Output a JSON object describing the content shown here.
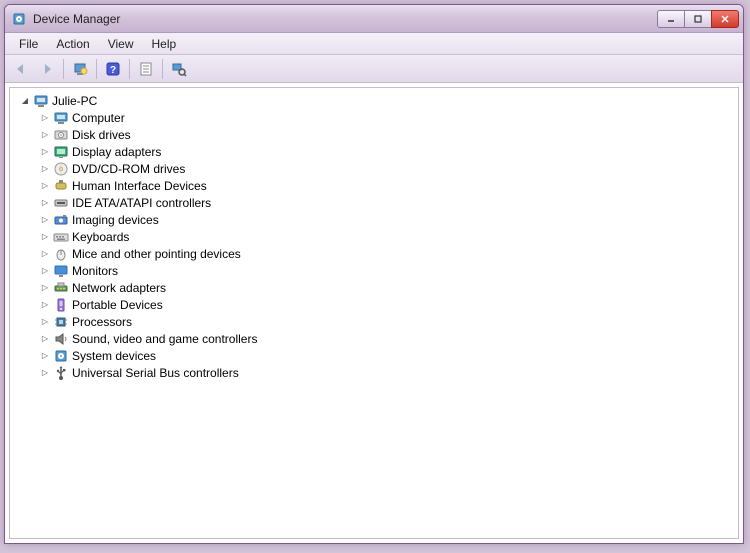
{
  "window": {
    "title": "Device Manager"
  },
  "menu": {
    "file": "File",
    "action": "Action",
    "view": "View",
    "help": "Help"
  },
  "tree": {
    "root": {
      "label": "Julie-PC",
      "icon": "computer"
    },
    "nodes": [
      {
        "label": "Computer",
        "icon": "computer"
      },
      {
        "label": "Disk drives",
        "icon": "disk"
      },
      {
        "label": "Display adapters",
        "icon": "display"
      },
      {
        "label": "DVD/CD-ROM drives",
        "icon": "dvd"
      },
      {
        "label": "Human Interface Devices",
        "icon": "hid"
      },
      {
        "label": "IDE ATA/ATAPI controllers",
        "icon": "ide"
      },
      {
        "label": "Imaging devices",
        "icon": "imaging"
      },
      {
        "label": "Keyboards",
        "icon": "keyboard"
      },
      {
        "label": "Mice and other pointing devices",
        "icon": "mouse"
      },
      {
        "label": "Monitors",
        "icon": "monitor"
      },
      {
        "label": "Network adapters",
        "icon": "network"
      },
      {
        "label": "Portable Devices",
        "icon": "portable"
      },
      {
        "label": "Processors",
        "icon": "cpu"
      },
      {
        "label": "Sound, video and game controllers",
        "icon": "sound"
      },
      {
        "label": "System devices",
        "icon": "system"
      },
      {
        "label": "Universal Serial Bus controllers",
        "icon": "usb"
      }
    ]
  }
}
